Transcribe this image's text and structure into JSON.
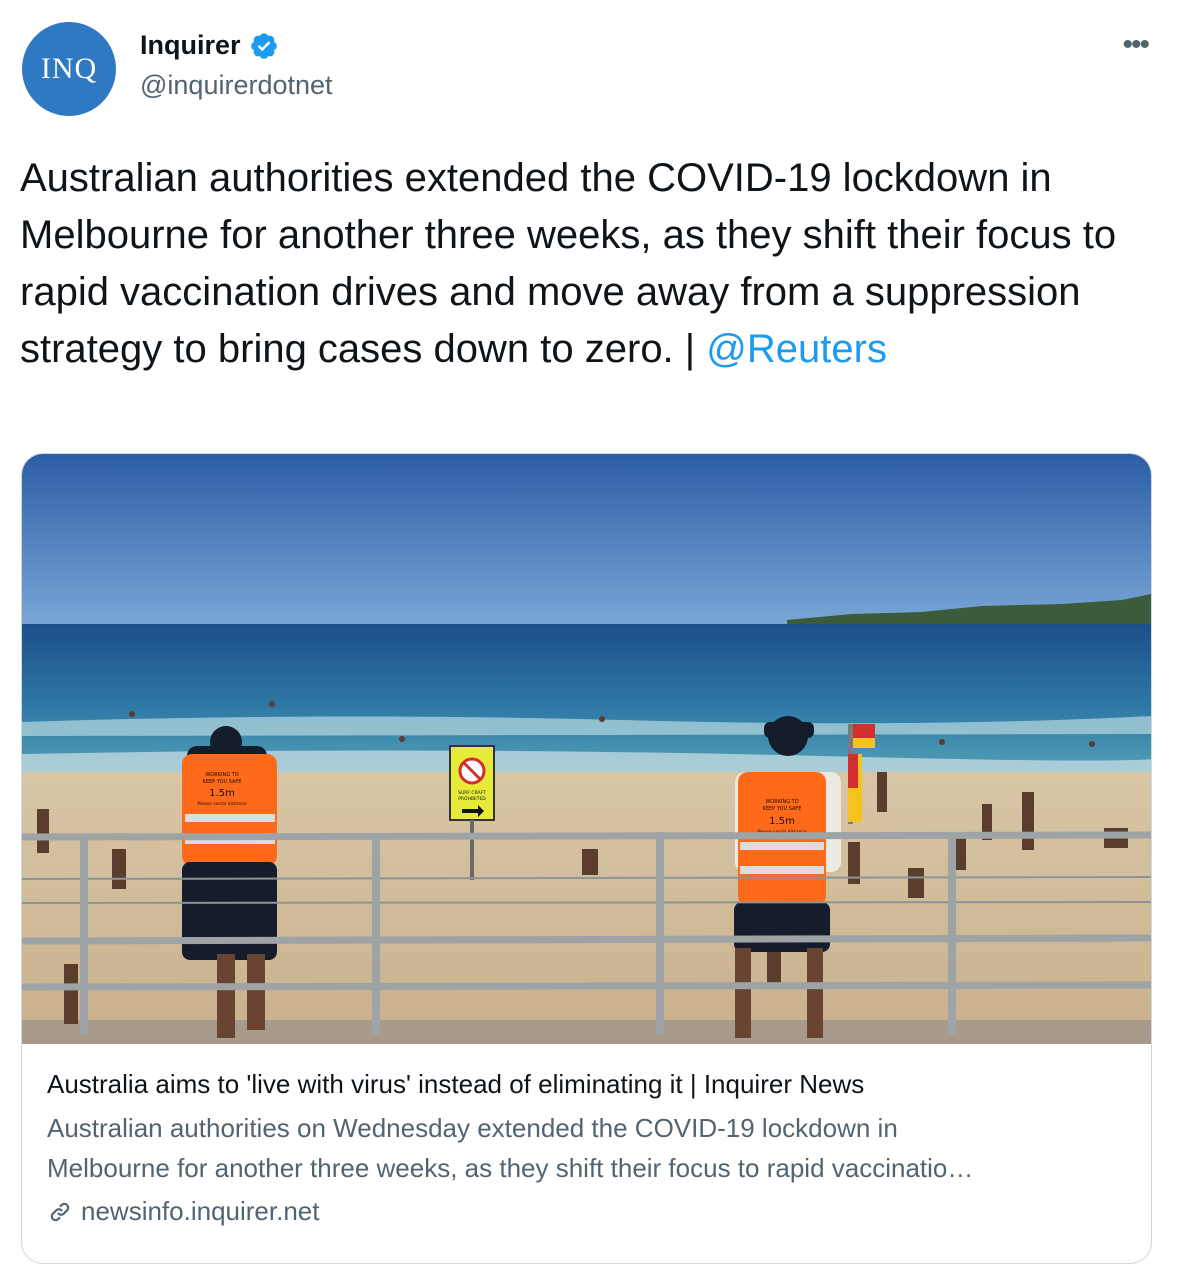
{
  "tweet": {
    "avatar_text": "INQ",
    "display_name": "Inquirer",
    "handle": "@inquirerdotnet",
    "more_label": "•••",
    "text": "Australian authorities extended the COVID-19 lockdown in Melbourne for another three weeks, as they shift their focus to rapid vaccination drives and move away from a suppression strategy to bring cases down to zero. | ",
    "mention": "@Reuters",
    "icons": [
      "verified-badge-icon",
      "more-options-icon",
      "link-icon"
    ]
  },
  "card": {
    "image_text": {
      "sign": [
        "SURF CRAFT",
        "PROHIBITED"
      ],
      "vest": [
        "WORKING TO",
        "KEEP YOU SAFE",
        "1.5m",
        "Please social distance"
      ]
    },
    "title": "Australia aims to 'live with virus' instead of eliminating it | Inquirer News",
    "description_line1": "Australian authorities on Wednesday extended the COVID-19 lockdown in",
    "description_line2": "Melbourne for another three weeks, as they shift their focus to rapid vaccinatio…",
    "domain": "newsinfo.inquirer.net"
  },
  "colors": {
    "accent": "#1d9bf0",
    "avatar_bg": "#2f79c2",
    "secondary_text": "#536471",
    "vest": "#ff6a1a"
  }
}
